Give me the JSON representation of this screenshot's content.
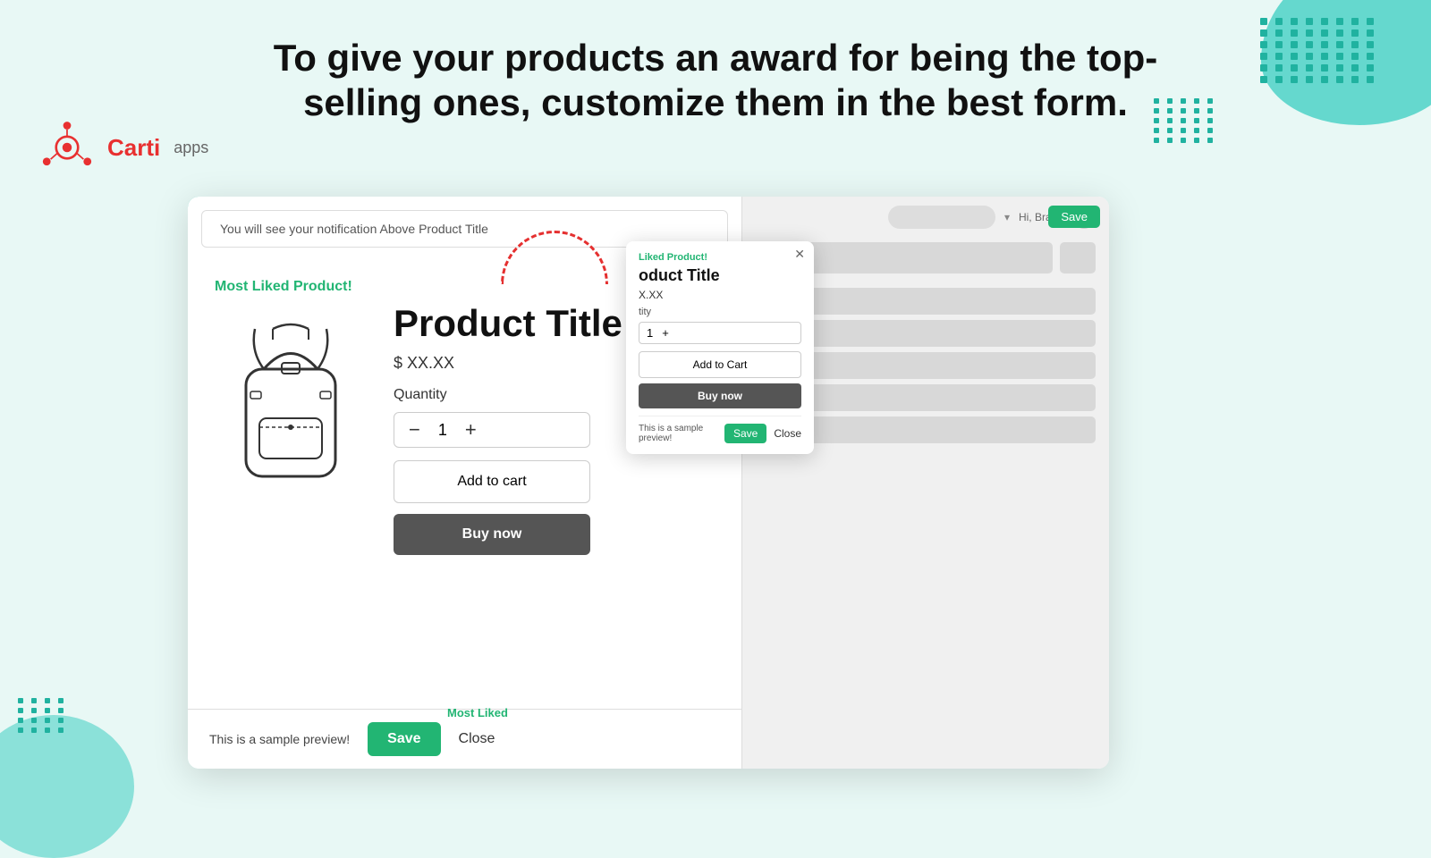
{
  "header": {
    "title": "To give your products an award for being the top-selling ones, customize them in the best form."
  },
  "logo": {
    "text": "Carti",
    "apps_label": "apps"
  },
  "sidebar": {
    "icons": [
      {
        "name": "home-icon",
        "symbol": "⌂",
        "active": true
      },
      {
        "name": "mail-icon",
        "symbol": "✉",
        "active": false
      },
      {
        "name": "chart-icon",
        "symbol": "▐",
        "active": false
      },
      {
        "name": "document-icon",
        "symbol": "🗋",
        "active": false
      },
      {
        "name": "monitor-icon",
        "symbol": "▭",
        "active": false
      },
      {
        "name": "clock-icon",
        "symbol": "◷",
        "active": false
      },
      {
        "name": "user-icon",
        "symbol": "👤",
        "active": false
      }
    ]
  },
  "notification_bar": {
    "text": "You will see your notification Above  Product Title"
  },
  "product": {
    "most_liked_label": "Most Liked Product!",
    "title": "Product Title",
    "price": "$ XX.XX",
    "quantity_label": "Quantity",
    "quantity_value": "1",
    "add_to_cart_label": "Add to cart",
    "buy_now_label": "Buy now"
  },
  "preview_footer": {
    "sample_text": "This is a sample preview!",
    "save_label": "Save",
    "close_label": "Close"
  },
  "floating_modal": {
    "liked_label": "Liked Product!",
    "title": "oduct Title",
    "price": "X.XX",
    "quantity_label": "tity",
    "quantity_value": "1",
    "add_to_cart_label": "Add to Cart",
    "buy_now_label": "Buy now",
    "preview_text": "This is a sample preview!",
    "save_label": "Save",
    "close_label": "Close"
  },
  "settings": {
    "save_label": "Save",
    "top_bar_name": "Hi, Brand"
  }
}
